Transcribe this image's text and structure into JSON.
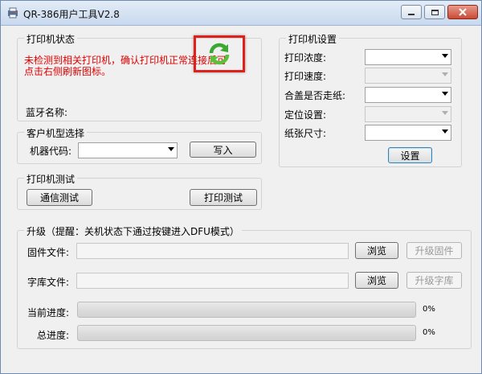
{
  "window": {
    "title": "QR-386用户工具V2.8"
  },
  "printer_status": {
    "legend": "打印机状态",
    "message": "未检测到相关打印机，确认打印机正常连接后可点击右侧刷新图标。",
    "bluetooth_label": "蓝牙名称:",
    "message_color": "#e00000"
  },
  "model_select": {
    "legend": "客户机型选择",
    "code_label": "机器代码:",
    "code_value": "",
    "write_button": "写入"
  },
  "printer_test": {
    "legend": "打印机测试",
    "comm_test_button": "通信测试",
    "print_test_button": "打印测试"
  },
  "printer_settings": {
    "legend": "打印机设置",
    "density_label": "打印浓度:",
    "speed_label": "打印速度:",
    "cover_label": "合盖是否走纸:",
    "position_label": "定位设置:",
    "paper_label": "纸张尺寸:",
    "set_button": "设置"
  },
  "upgrade": {
    "legend": "升级（提醒：关机状态下通过按键进入DFU模式）",
    "firmware_label": "固件文件:",
    "firmware_path": "",
    "firmware_browse": "浏览",
    "firmware_upgrade": "升级固件",
    "font_label": "字库文件:",
    "font_path": "",
    "font_browse": "浏览",
    "font_upgrade": "升级字库",
    "current_label": "当前进度:",
    "current_progress": 0,
    "current_text": "0%",
    "total_label": "总进度:",
    "total_progress": 0,
    "total_text": "0%"
  },
  "icons": {
    "refresh": "refresh-icon",
    "highlight_color": "#e0201b",
    "refresh_color": "#3aa832"
  }
}
